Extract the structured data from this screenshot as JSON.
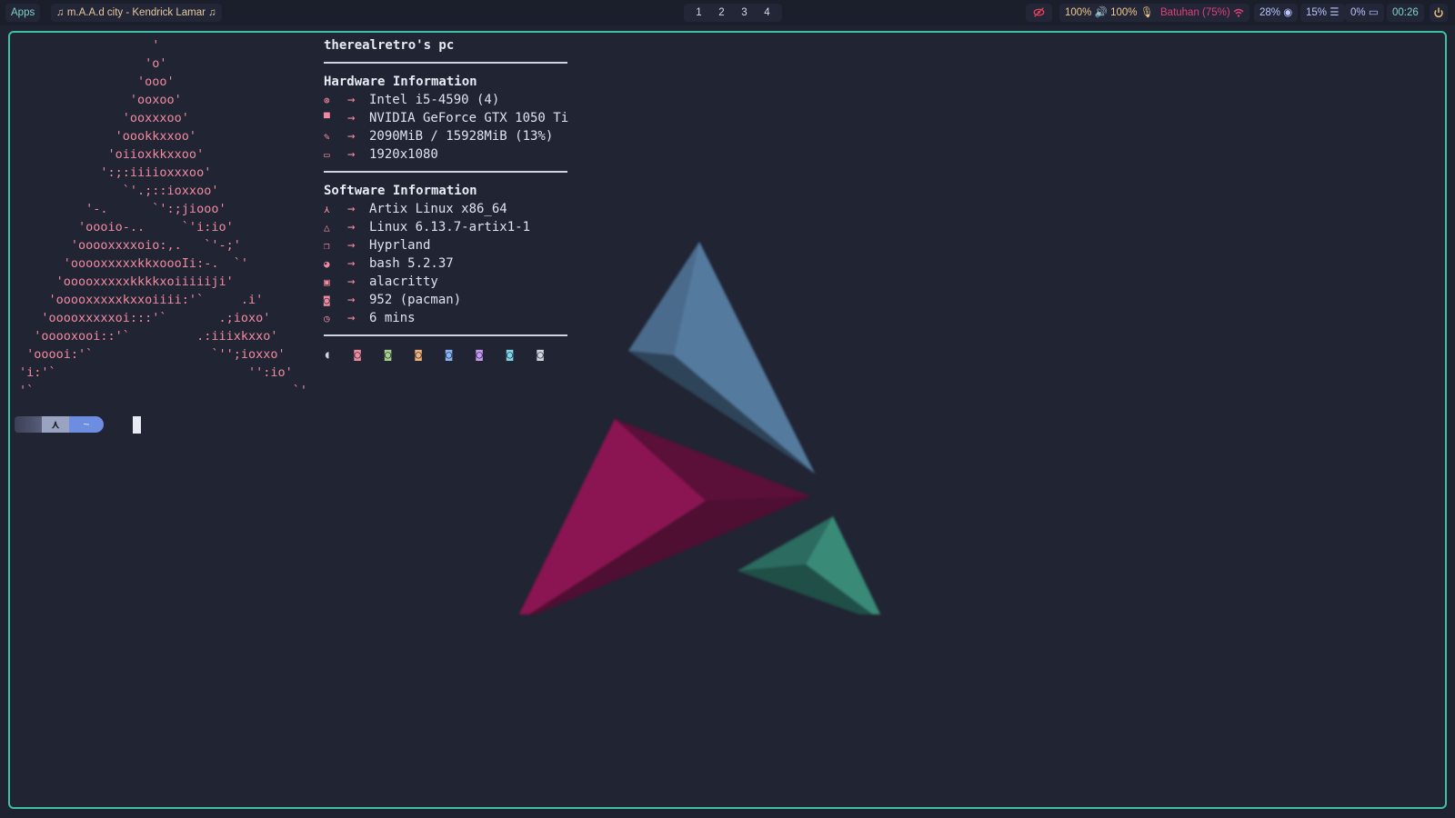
{
  "topbar": {
    "apps_label": "Apps",
    "now_playing": "♫ m.A.A.d city - Kendrick Lamar ♫",
    "workspaces": [
      "1",
      "2",
      "3",
      "4"
    ],
    "privacy_icon": "eye-off-icon",
    "volume": "100% 🔊 100% 🎙",
    "network": "Batuhan (75%) ",
    "cpu": "28% ◉",
    "memory": "15% ☰",
    "battery": "0% ▭",
    "clock": "00:26",
    "power_icon": "power-icon",
    "accent_color": "#3fbfa8"
  },
  "terminal": {
    "ascii_art": [
      "                  '",
      "                 'o'",
      "                'ooo'",
      "               'ooxoo'",
      "              'ooxxxoo'",
      "             'oookkxxoo'",
      "            'oiioxkkxxoo'",
      "           ':;:iiiioxxxoo'",
      "              `'.;::ioxxoo'",
      "         '-.      `':;jiooo'",
      "        'oooio-..     `'i:io'",
      "       'ooooxxxxoio:,.   `'-;'",
      "      'ooooxxxxxkkxoooIi:-.  `'",
      "     'ooooxxxxxkkkkxoiiiiiji'",
      "    'ooooxxxxxkxxoiiii:'`     .i'",
      "   'ooooxxxxxoi:::'`       .;ioxo'",
      "  'ooooxooi::'`         .:iiixkxxo'",
      " 'ooooi:'`                `'';ioxxo'",
      "'i:'`                          '':io'",
      "'`                                   `'"
    ],
    "hostname": "therealretro's pc",
    "hardware_title": "Hardware Information",
    "hardware": [
      {
        "icon": "cpu-icon",
        "glyph": "⊛",
        "value": "Intel i5-4590 (4)"
      },
      {
        "icon": "gpu-icon",
        "glyph": "▀",
        "value": "NVIDIA GeForce GTX 1050 Ti"
      },
      {
        "icon": "memory-icon",
        "glyph": "✎",
        "value": "2090MiB / 15928MiB (13%)"
      },
      {
        "icon": "display-icon",
        "glyph": "▭",
        "value": "1920x1080"
      }
    ],
    "software_title": "Software Information",
    "software": [
      {
        "icon": "artix-icon",
        "glyph": "⋏",
        "value": "Artix Linux x86_64"
      },
      {
        "icon": "linux-icon",
        "glyph": "△",
        "value": "Linux 6.13.7-artix1-1"
      },
      {
        "icon": "window-manager-icon",
        "glyph": "❐",
        "value": "Hyprland"
      },
      {
        "icon": "shell-icon",
        "glyph": "◕",
        "value": "bash 5.2.37"
      },
      {
        "icon": "terminal-icon",
        "glyph": "▣",
        "value": "alacritty"
      },
      {
        "icon": "package-icon",
        "glyph": "◙",
        "value": "952 (pacman)"
      },
      {
        "icon": "clock-icon",
        "glyph": "◷",
        "value": "6 mins"
      }
    ],
    "arrow": "→",
    "palette": [
      {
        "glyph": "◖",
        "color": "#cfd4df"
      },
      {
        "glyph": "◙",
        "color": "#f08aa0"
      },
      {
        "glyph": "◙",
        "color": "#a6d189"
      },
      {
        "glyph": "◙",
        "color": "#f0b27a"
      },
      {
        "glyph": "◙",
        "color": "#8ab4f8"
      },
      {
        "glyph": "◙",
        "color": "#c79bf2"
      },
      {
        "glyph": "◙",
        "color": "#7fd4e8"
      },
      {
        "glyph": "◙",
        "color": "#cfd4df"
      }
    ],
    "prompt": {
      "os_glyph": "⋏",
      "dir": "~"
    }
  }
}
